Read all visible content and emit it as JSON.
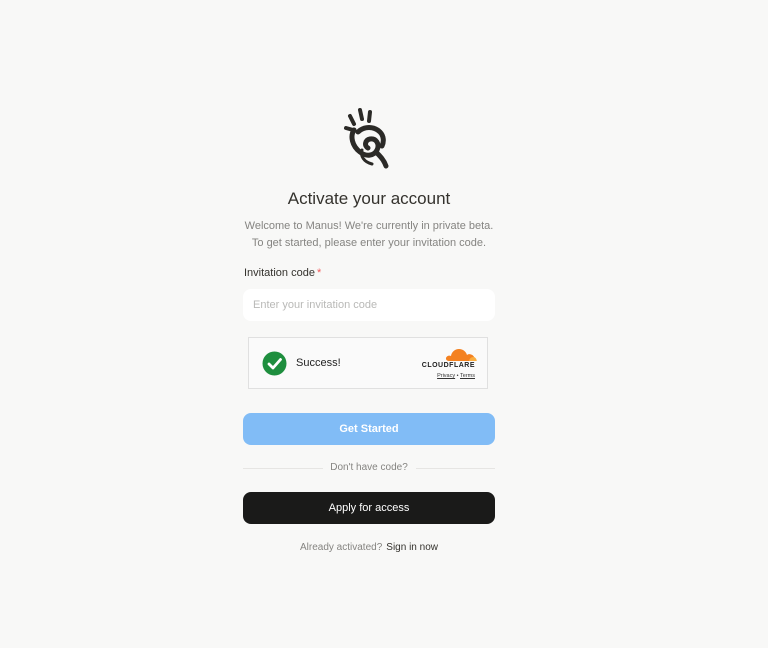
{
  "brand": {
    "logo_icon": "manus-hand-logo-icon"
  },
  "form": {
    "title": "Activate your account",
    "subtitle_line1": "Welcome to Manus! We're currently in private beta.",
    "subtitle_line2": "To get started, please enter your invitation code.",
    "invitation_label": "Invitation code",
    "required_mark": "*",
    "invitation_value": "",
    "invitation_placeholder": "Enter your invitation code",
    "submit_label": "Get Started",
    "divider_text": "Don't have code?",
    "apply_label": "Apply for access",
    "signin_prompt": "Already activated?",
    "signin_link": "Sign in now"
  },
  "captcha": {
    "status_icon": "check-circle-icon",
    "status": "Success!",
    "brand": "CLOUDFLARE",
    "brand_icon": "cloudflare-cloud-icon",
    "privacy_label": "Privacy",
    "separator": "•",
    "terms_label": "Terms"
  },
  "colors": {
    "background": "#f8f8f7",
    "primary_button": "#81bcf6",
    "apply_button": "#1a1a19",
    "success_green": "#1e8e3e",
    "cloudflare_orange": "#f48120",
    "required_red": "#f25a5a"
  }
}
